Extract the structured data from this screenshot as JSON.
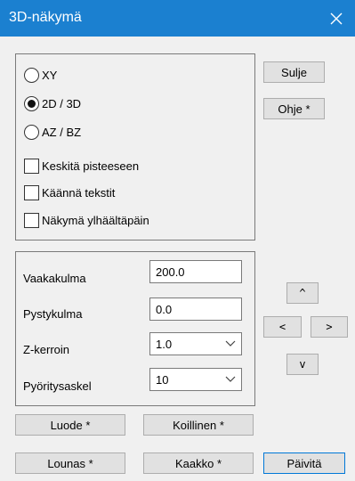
{
  "window": {
    "title": "3D-näkymä"
  },
  "views": [
    {
      "label": "XY",
      "selected": false
    },
    {
      "label": "2D / 3D",
      "selected": true
    },
    {
      "label": "AZ / BZ",
      "selected": false
    }
  ],
  "options": [
    {
      "label": "Keskitä pisteeseen",
      "checked": false
    },
    {
      "label": "Käännä tekstit",
      "checked": false
    },
    {
      "label": "Näkymä ylhäältäpäin",
      "checked": false
    }
  ],
  "fields": {
    "vaakakulma": {
      "label": "Vaakakulma",
      "value": "200.0"
    },
    "pystykulma": {
      "label": "Pystykulma",
      "value": "0.0"
    },
    "zkerroin": {
      "label": "Z-kerroin",
      "value": "1.0"
    },
    "pyoritysaskel": {
      "label": "Pyöritysaskel",
      "value": "10"
    }
  },
  "buttons": {
    "sulje": "Sulje",
    "ohje": "Ohje *",
    "up": "^",
    "left": "<",
    "right": ">",
    "down": "v",
    "luode": "Luode *",
    "koillinen": "Koillinen *",
    "lounas": "Lounas *",
    "kaakko": "Kaakko *",
    "paivita": "Päivitä"
  },
  "colors": {
    "titlebar": "#1b80d0",
    "focus": "#0078d7"
  }
}
